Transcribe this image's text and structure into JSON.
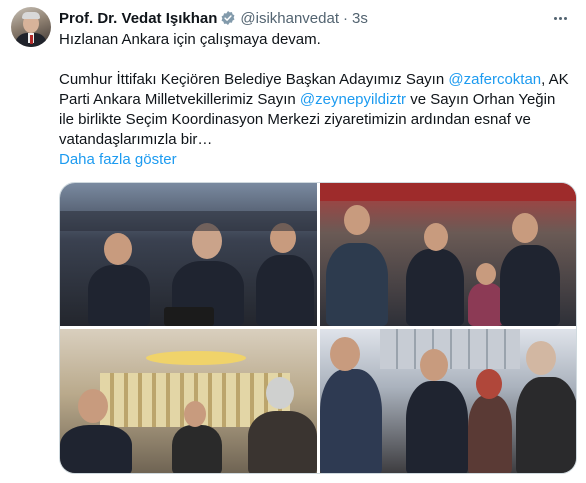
{
  "tweet": {
    "author_name": "Prof. Dr. Vedat Işıkhan",
    "handle": "@isikhanvedat",
    "separator": "·",
    "time": "3s",
    "lines": [
      "Hızlanan Ankara için çalışmaya devam.",
      "",
      "Cumhur İttifakı Keçiören Belediye Başkan Adayımız Sayın",
      "Parti Ankara Milletvekillerimiz Sayın",
      "ile birlikte Seçim Koordinasyon Merkezi ziyaretimizin ardından esnaf ve",
      "vatandaşlarımızla bir…"
    ],
    "mention_1": "@zafercoktan",
    "line3_tail": ", AK",
    "mention_2": "@zeynepyildiztr",
    "line4_tail": " ve Sayın Orhan Yeğin",
    "show_more": "Daha fazla göster"
  },
  "icons": {
    "verified": "verified-badge-icon",
    "more": "more-options-icon"
  },
  "colors": {
    "link": "#1d9bf0",
    "secondary_text": "#536471",
    "verified_badge": "#829aab"
  }
}
